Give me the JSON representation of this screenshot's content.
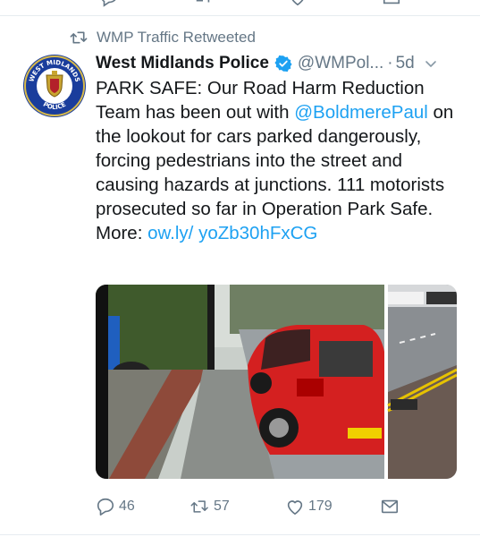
{
  "retweet_context": {
    "label": "WMP Traffic Retweeted",
    "icon": "retweet-icon"
  },
  "author": {
    "name": "West Midlands Police",
    "handle": "@WMPol...",
    "age": "5d",
    "verified": true,
    "avatar_icon": "police-crest-icon",
    "avatar_text_top": "WEST MIDLANDS",
    "avatar_text_bottom": "POLICE"
  },
  "tweet": {
    "text_lead": "PARK SAFE: Our Road Harm Reduction Team has been out with ",
    "mention": "@BoldmerePaul",
    "text_body": " on the lookout for cars parked dangerously, forcing pedestrians into the street and causing hazards at junctions. 111 motorists prosecuted so far in Operation Park Safe. More: ",
    "link": "ow.ly/ yoZb30hFxCG"
  },
  "media": {
    "description_icon": "photo-red-car-on-pavement",
    "count": 2
  },
  "actions": {
    "reply_count": "46",
    "retweet_count": "57",
    "like_count": "179"
  },
  "colors": {
    "link": "#1da1f2",
    "secondary_text": "#657786",
    "verified_badge": "#1da1f2",
    "divider": "#e6ecf0"
  }
}
